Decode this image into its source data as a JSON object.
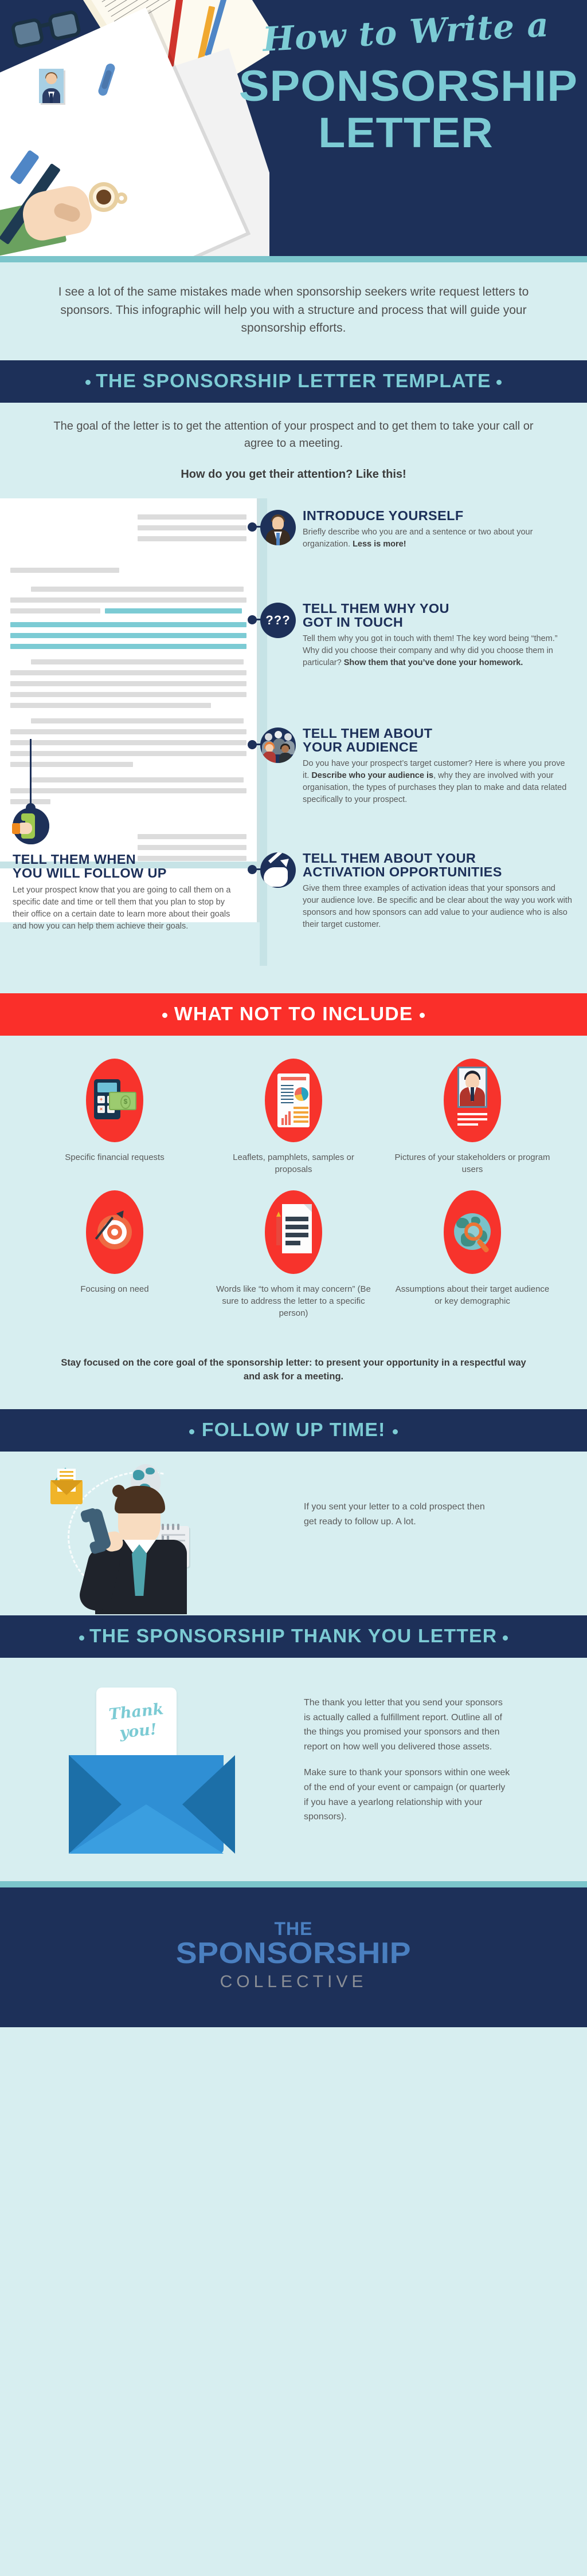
{
  "hero": {
    "script_line": "How to Write a",
    "title_line1": "SPONSORSHIP",
    "title_line2": "LETTER"
  },
  "intro": {
    "paragraph": "I see a lot of the same mistakes made when sponsorship seekers write request letters to sponsors. This infographic will help you with a structure and process that will guide your sponsorship efforts."
  },
  "template_section": {
    "heading": "THE SPONSORSHIP LETTER TEMPLATE",
    "goal": "The goal of the letter is to get the attention of your prospect and to get them to take your call or agree to a meeting.",
    "attention": "How do you get their attention? Like this!",
    "steps": [
      {
        "icon": "businessman-avatar-icon",
        "title": "INTRODUCE YOURSELF",
        "body": "Briefly describe who you are and a sentence or two about your organization. ",
        "bold": "Less is more!"
      },
      {
        "icon": "question-marks-icon",
        "title_line1": "TELL THEM WHY YOU",
        "title_line2": "GOT IN TOUCH",
        "body": "Tell them why you got in touch with them! The key word being “them.” Why did you choose their company and why did you choose them in particular? ",
        "bold": "Show them that you’ve done your homework."
      },
      {
        "icon": "crowd-audience-icon",
        "title_line1": "TELL THEM ABOUT",
        "title_line2": "YOUR AUDIENCE",
        "body_pre": "Do you have your prospect’s target customer? Here is where you prove it. ",
        "bold": "Describe who your audience is",
        "body_post": ", why they are involved with your organisation, the types of purchases they plan to make and data related specifically to your prospect."
      },
      {
        "icon": "growth-arrow-icon",
        "title_line1": "TELL THEM ABOUT YOUR",
        "title_line2": "ACTIVATION OPPORTUNITIES",
        "body": "Give them three examples of activation ideas that your sponsors and your audience love. Be specific and be clear about the way you work with sponsors and how sponsors can add value to your audience who is also their target customer."
      }
    ],
    "followup_step": {
      "icon": "telephone-handset-icon",
      "title_line1": "TELL THEM WHEN",
      "title_line2": "YOU WILL FOLLOW UP",
      "body": "Let your prospect know that you are going to call them on a specific date and time or tell them that you plan to stop by their office on a certain date to learn more about their goals and how you can help them achieve their goals."
    }
  },
  "not_include_section": {
    "heading": "WHAT NOT TO INCLUDE",
    "items": [
      {
        "icon": "calculator-money-icon",
        "caption": "Specific financial requests"
      },
      {
        "icon": "leaflet-report-icon",
        "caption": "Leaflets, pamphlets, samples or proposals"
      },
      {
        "icon": "person-photo-icon",
        "caption": "Pictures of your stakeholders or program users"
      },
      {
        "icon": "target-arrow-icon",
        "caption": "Focusing on need"
      },
      {
        "icon": "document-pencil-icon",
        "caption": "Words like “to whom it may concern” (Be sure to address the letter to a specific person)"
      },
      {
        "icon": "globe-magnifier-icon",
        "caption": "Assumptions about their target audience or key demographic"
      }
    ],
    "closing": "Stay focused on the core goal of the sponsorship letter: to present your opportunity in a respectful way and ask for a meeting."
  },
  "followup_section": {
    "heading": "FOLLOW UP TIME!",
    "text": "If you sent your letter to a cold prospect then get ready to follow up. A lot."
  },
  "thankyou_section": {
    "heading": "THE SPONSORSHIP THANK YOU LETTER",
    "card_line1": "Thank",
    "card_line2": "you!",
    "paragraph1": "The thank you letter that you send your sponsors is actually called a fulfillment report. Outline all of the things you promised your sponsors and then report on how well you delivered those assets.",
    "paragraph2": "Make sure to thank your sponsors within one week of the end of your event or campaign (or quarterly if you have a yearlong relationship with your sponsors)."
  },
  "footer": {
    "logo_the": "THE",
    "logo_sponsorship": "SPONSORSHIP",
    "logo_collective": "COLLECTIVE"
  },
  "colors": {
    "navy": "#1d3059",
    "teal": "#7ccbd4",
    "light_bg": "#d7eef0",
    "red": "#f7332c",
    "rule": "#7bc5cb"
  }
}
